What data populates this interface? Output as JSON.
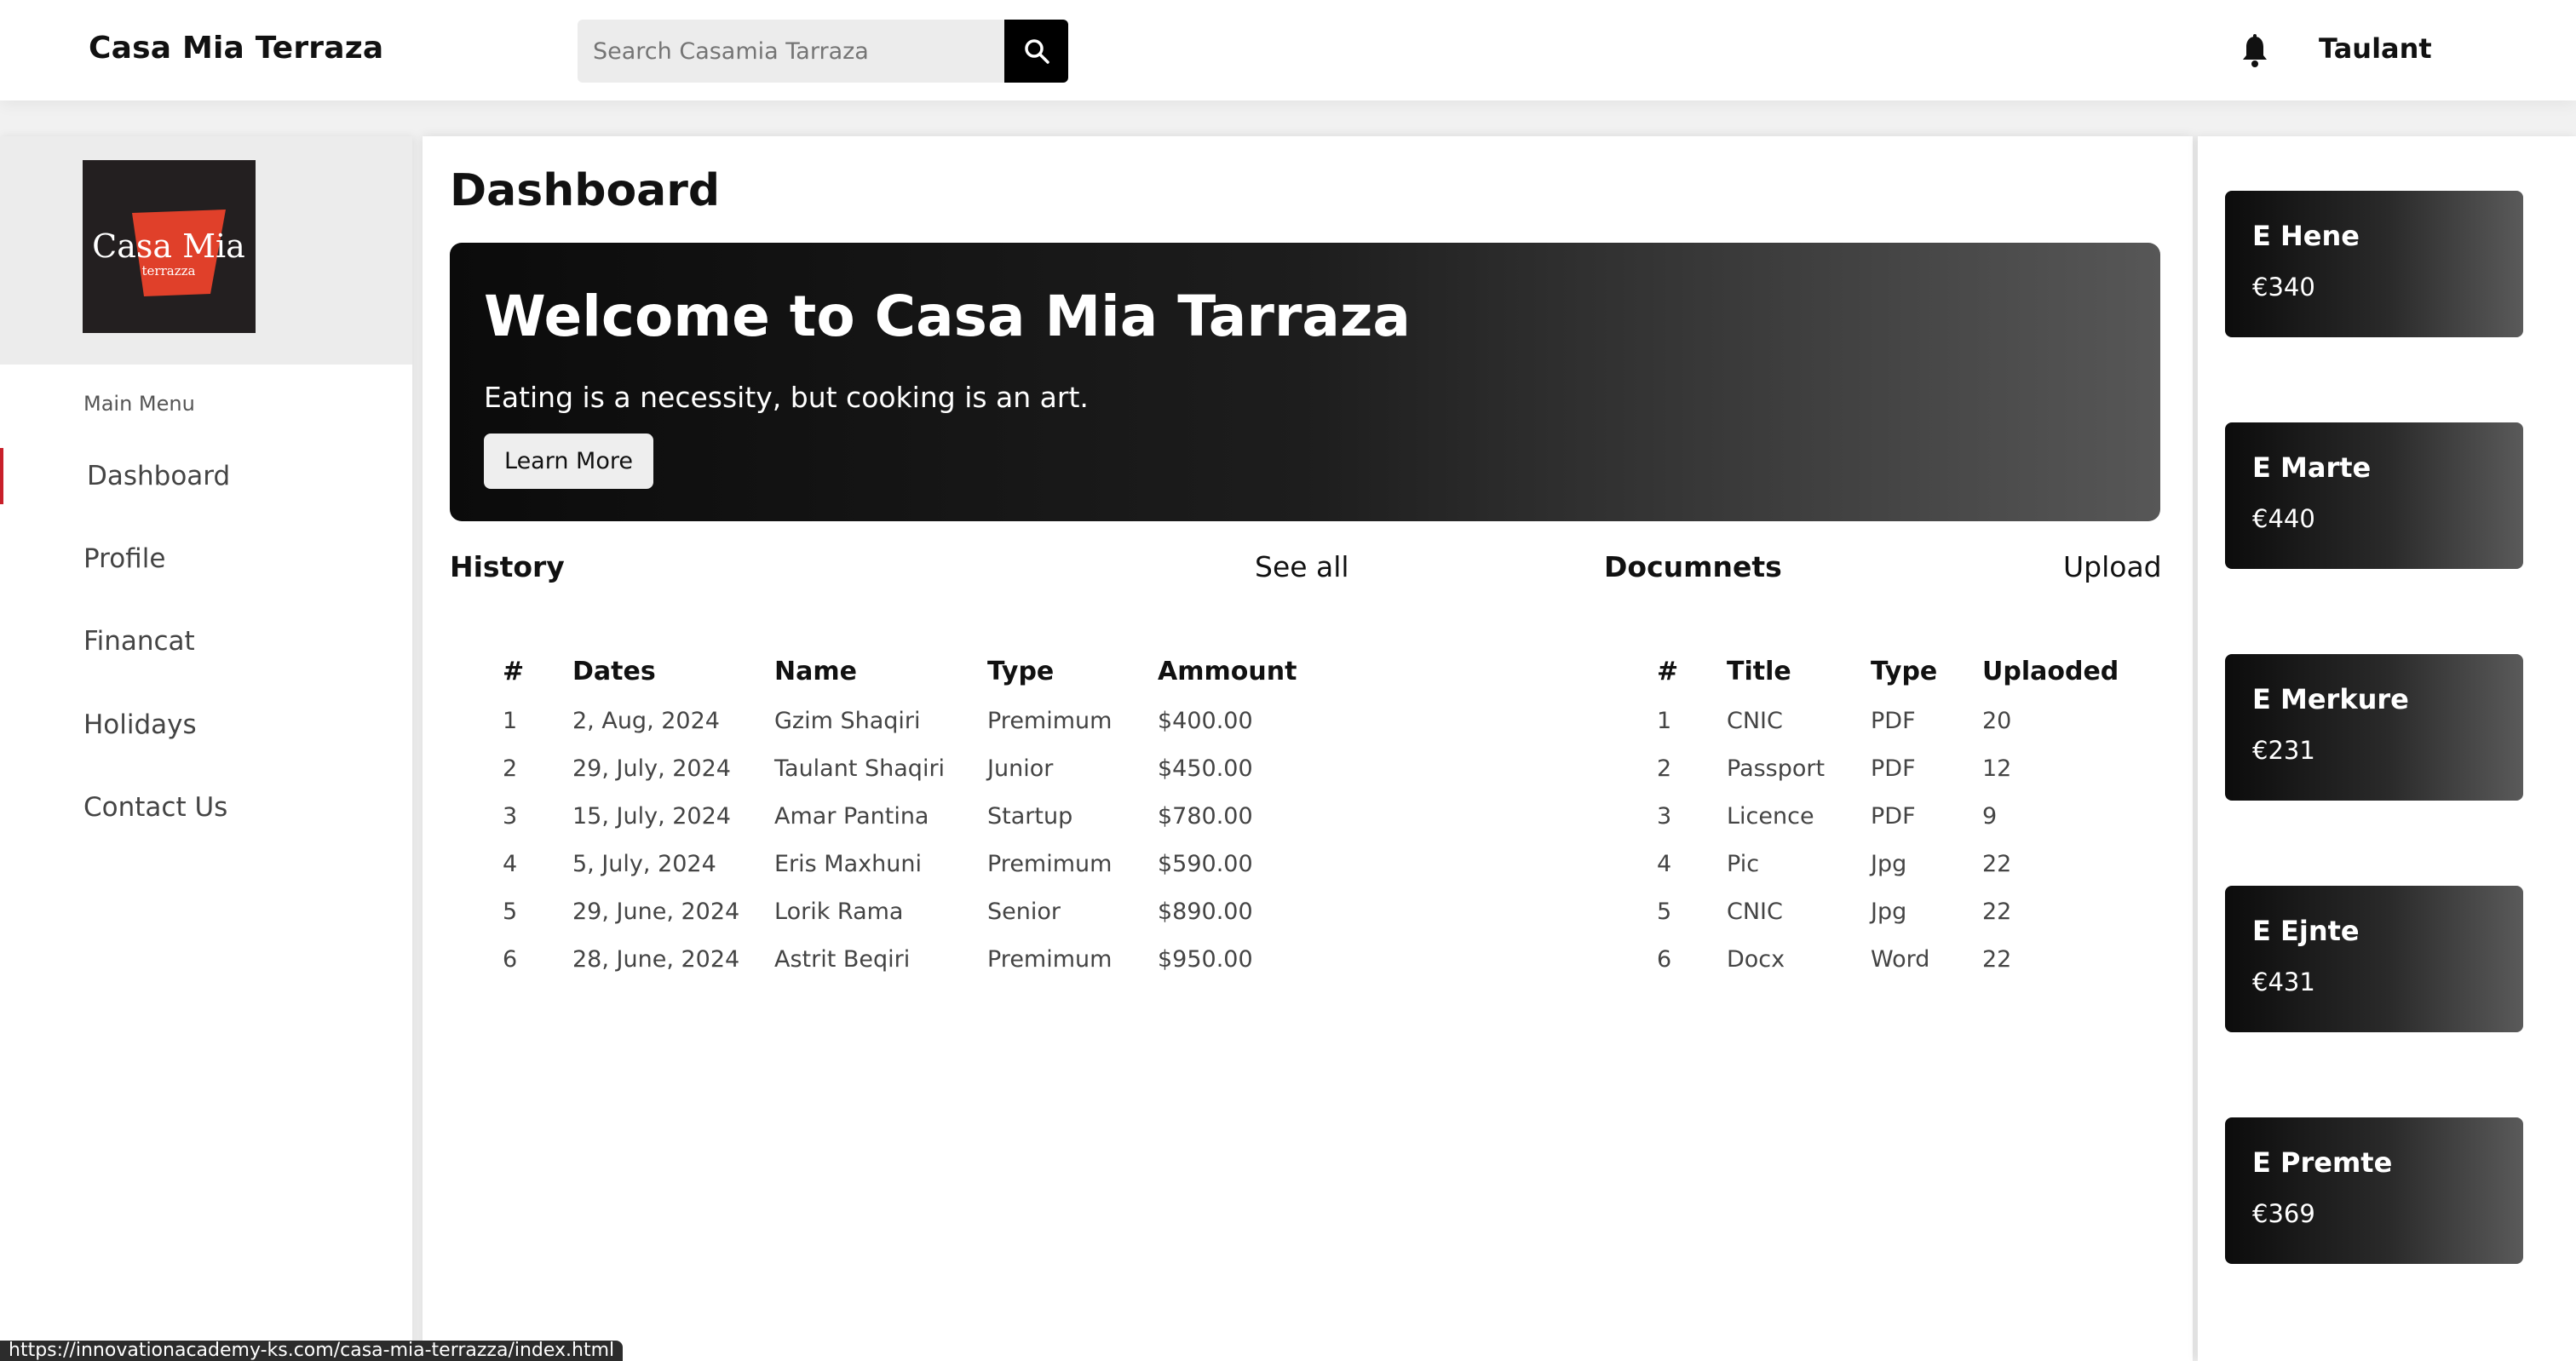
{
  "header": {
    "brand": "Casa Mia Terraza",
    "search_placeholder": "Search Casamia Tarraza",
    "user": "Taulant"
  },
  "sidebar": {
    "logo_text": "Casa Mia",
    "logo_sub": "terrazza",
    "menu_title": "Main Menu",
    "items": [
      {
        "label": "Dashboard",
        "active": true
      },
      {
        "label": "Profile"
      },
      {
        "label": "Financat"
      },
      {
        "label": "Holidays"
      },
      {
        "label": "Contact Us"
      }
    ]
  },
  "main": {
    "title": "Dashboard",
    "hero": {
      "title": "Welcome to Casa Mia Tarraza",
      "subtitle": "Eating is a necessity, but cooking is an art.",
      "button": "Learn More"
    },
    "history": {
      "heading": "History",
      "link": "See all",
      "columns": [
        "#",
        "Dates",
        "Name",
        "Type",
        "Ammount"
      ],
      "rows": [
        [
          "1",
          "2, Aug, 2024",
          "Gzim Shaqiri",
          "Premimum",
          "$400.00"
        ],
        [
          "2",
          "29, July, 2024",
          "Taulant Shaqiri",
          "Junior",
          "$450.00"
        ],
        [
          "3",
          "15, July, 2024",
          "Amar Pantina",
          "Startup",
          "$780.00"
        ],
        [
          "4",
          "5, July, 2024",
          "Eris Maxhuni",
          "Premimum",
          "$590.00"
        ],
        [
          "5",
          "29, June, 2024",
          "Lorik Rama",
          "Senior",
          "$890.00"
        ],
        [
          "6",
          "28, June, 2024",
          "Astrit Beqiri",
          "Premimum",
          "$950.00"
        ]
      ]
    },
    "documents": {
      "heading": "Documnets",
      "link": "Upload",
      "columns": [
        "#",
        "Title",
        "Type",
        "Uplaoded"
      ],
      "rows": [
        [
          "1",
          "CNIC",
          "PDF",
          "20"
        ],
        [
          "2",
          "Passport",
          "PDF",
          "12"
        ],
        [
          "3",
          "Licence",
          "PDF",
          "9"
        ],
        [
          "4",
          "Pic",
          "Jpg",
          "22"
        ],
        [
          "5",
          "CNIC",
          "Jpg",
          "22"
        ],
        [
          "6",
          "Docx",
          "Word",
          "22"
        ]
      ]
    }
  },
  "days": [
    {
      "name": "E Hene",
      "amount": "€340"
    },
    {
      "name": "E Marte",
      "amount": "€440"
    },
    {
      "name": "E Merkure",
      "amount": "€231"
    },
    {
      "name": "E Ejnte",
      "amount": "€431"
    },
    {
      "name": "E Premte",
      "amount": "€369"
    }
  ],
  "status_url": "https://innovationacademy-ks.com/casa-mia-terrazza/index.html",
  "colors": {
    "accent": "#c8202a",
    "logo_red": "#e0402a",
    "dark": "#000000"
  }
}
